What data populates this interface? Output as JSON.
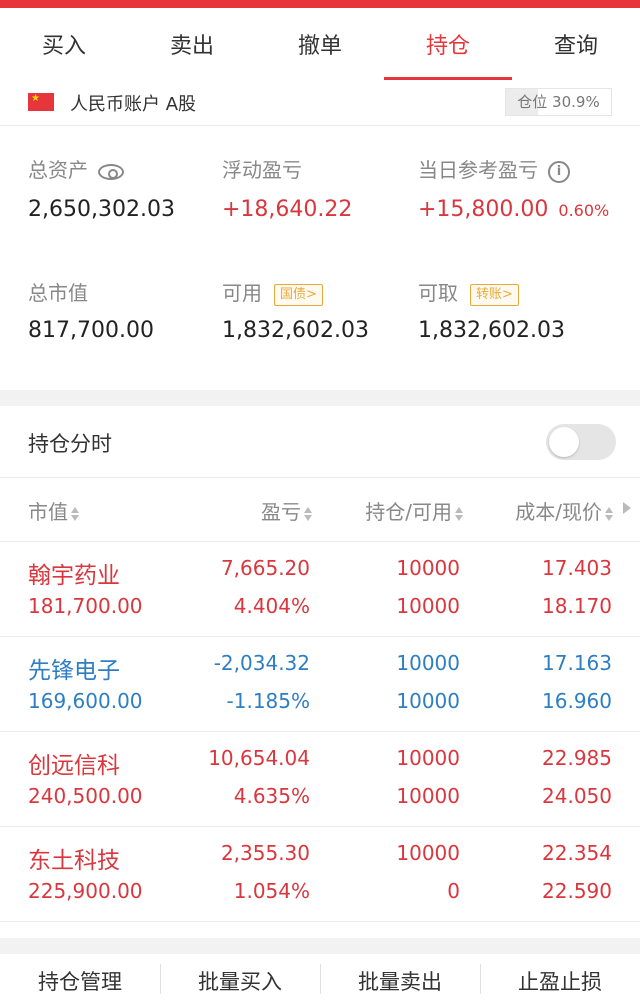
{
  "tabs": [
    {
      "label": "买入",
      "active": false
    },
    {
      "label": "卖出",
      "active": false
    },
    {
      "label": "撤单",
      "active": false
    },
    {
      "label": "持仓",
      "active": true
    },
    {
      "label": "查询",
      "active": false
    }
  ],
  "account": {
    "label": "人民币账户 A股",
    "position_label": "仓位 30.9%",
    "position_ratio": 0.309
  },
  "metrics": {
    "total_assets": {
      "label": "总资产",
      "value": "2,650,302.03"
    },
    "floating_pl": {
      "label": "浮动盈亏",
      "value": "+18,640.22"
    },
    "daily_pl": {
      "label": "当日参考盈亏",
      "value": "+15,800.00",
      "pct": "0.60%"
    },
    "market_value": {
      "label": "总市值",
      "value": "817,700.00"
    },
    "available": {
      "label": "可用",
      "tag": "国债>",
      "value": "1,832,602.03"
    },
    "withdrawable": {
      "label": "可取",
      "tag": "转账>",
      "value": "1,832,602.03"
    }
  },
  "timeshare": {
    "label": "持仓分时",
    "enabled": false
  },
  "table": {
    "headers": {
      "mv": "市值",
      "pl": "盈亏",
      "hold": "持仓/可用",
      "cost": "成本/现价"
    },
    "rows": [
      {
        "name": "翰宇药业",
        "mv": "181,700.00",
        "pl": "7,665.20",
        "plp": "4.404%",
        "hold": "10000",
        "avail": "10000",
        "cost": "17.403",
        "price": "18.170",
        "dir": "up"
      },
      {
        "name": "先锋电子",
        "mv": "169,600.00",
        "pl": "-2,034.32",
        "plp": "-1.185%",
        "hold": "10000",
        "avail": "10000",
        "cost": "17.163",
        "price": "16.960",
        "dir": "down"
      },
      {
        "name": "创远信科",
        "mv": "240,500.00",
        "pl": "10,654.04",
        "plp": "4.635%",
        "hold": "10000",
        "avail": "10000",
        "cost": "22.985",
        "price": "24.050",
        "dir": "up"
      },
      {
        "name": "东土科技",
        "mv": "225,900.00",
        "pl": "2,355.30",
        "plp": "1.054%",
        "hold": "10000",
        "avail": "0",
        "cost": "22.354",
        "price": "22.590",
        "dir": "up"
      }
    ]
  },
  "bottom": [
    "持仓管理",
    "批量买入",
    "批量卖出",
    "止盈止损"
  ],
  "colors": {
    "accent": "#e6363c",
    "up": "#d9373d",
    "down": "#2e7ec3",
    "tag": "#e8a93a"
  }
}
